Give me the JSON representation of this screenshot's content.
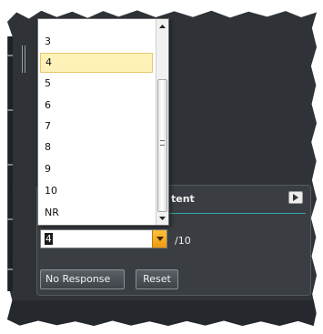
{
  "panel": {
    "title": "tent",
    "play_icon": "play-icon"
  },
  "score": {
    "selected_value": "4",
    "max_label": "/10"
  },
  "buttons": {
    "no_response": "No Response",
    "reset": "Reset"
  },
  "dropdown": {
    "options": [
      "3",
      "4",
      "5",
      "6",
      "7",
      "8",
      "9",
      "10",
      "NR"
    ],
    "highlighted": "4"
  },
  "colors": {
    "accent": "#2ea8a8",
    "select_arrow": "#f5a623",
    "highlight": "#fff2b8",
    "background": "#2f3338"
  }
}
